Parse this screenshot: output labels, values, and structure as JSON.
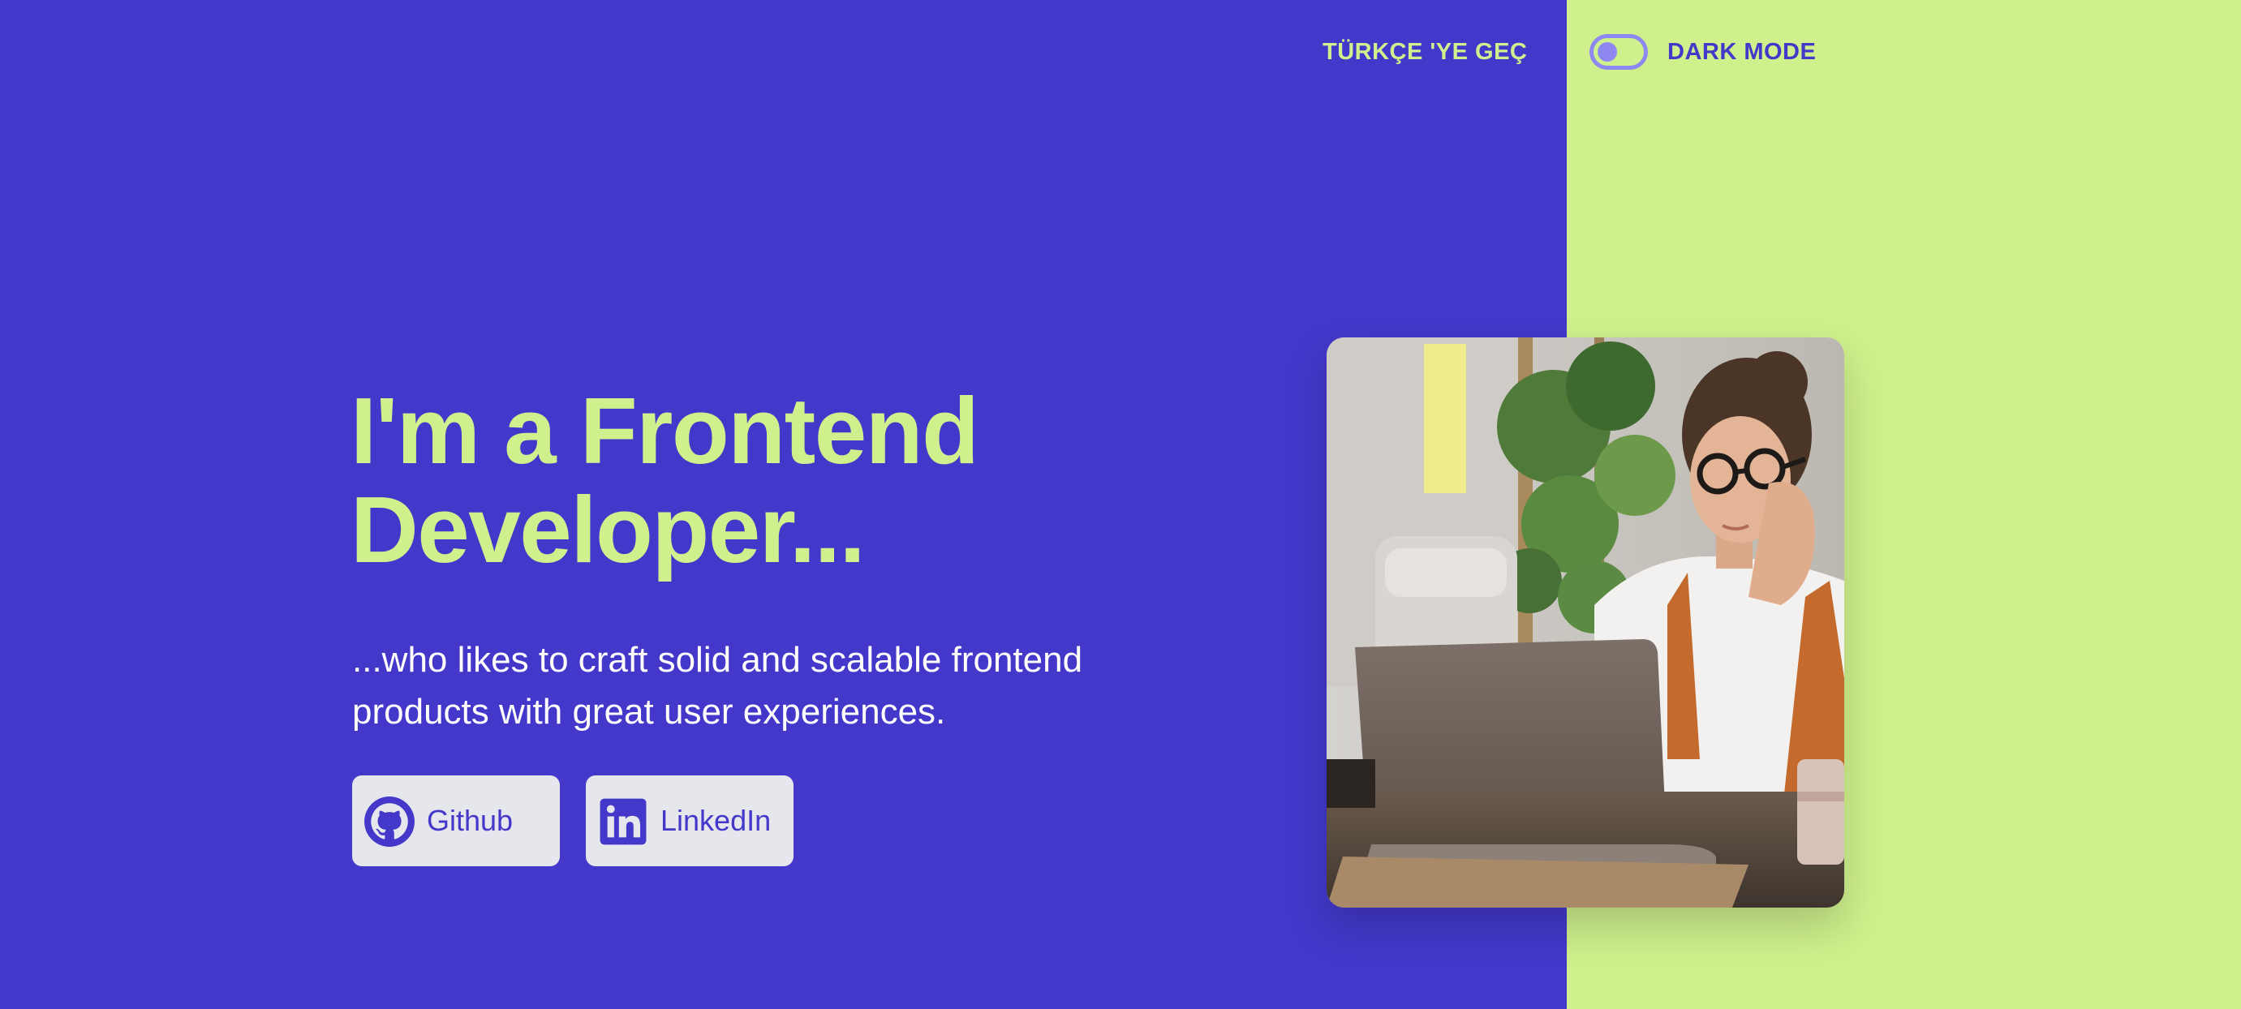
{
  "header": {
    "language_switch_label": "TÜRKÇE 'YE GEÇ",
    "dark_mode_label": "DARK MODE",
    "dark_mode_on": false
  },
  "hero": {
    "headline_line1": "I'm a Frontend",
    "headline_line2": "Developer...",
    "subtitle_line1": "...who likes to craft solid and scalable frontend",
    "subtitle_line2": "products with great user experiences.",
    "buttons": [
      {
        "label": "Github",
        "icon": "github-icon"
      },
      {
        "label": "LinkedIn",
        "icon": "linkedin-icon"
      }
    ],
    "photo_icon": "woman-at-laptop-photo"
  },
  "colors": {
    "primary": "#4338CA",
    "accent": "#CFF08C",
    "button_bg": "#E6E7EC",
    "toggle": "#8F88F0",
    "white": "#FFFFFF"
  }
}
